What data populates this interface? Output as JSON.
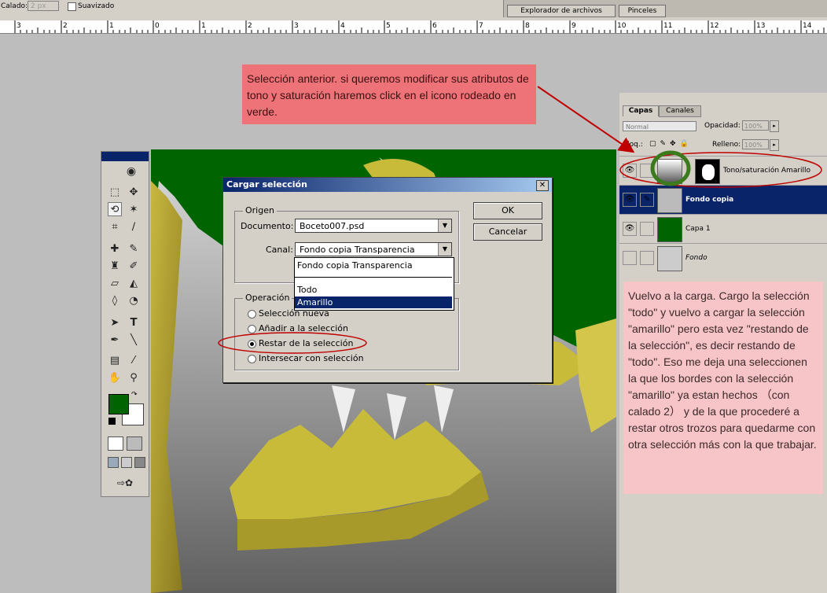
{
  "options_bar": {
    "calado_label": "Calado:",
    "calado_value": "2 px",
    "suavizado_label": "Suavizado"
  },
  "palette_well": {
    "tabs": [
      "Explorador de archivos",
      "Pinceles"
    ]
  },
  "ruler": {
    "ticks": [
      "3",
      "2",
      "1",
      "0",
      "1",
      "2",
      "3",
      "4",
      "5",
      "6",
      "7",
      "8",
      "9",
      "10",
      "11",
      "12",
      "13",
      "14"
    ]
  },
  "notes": {
    "top": "Selección anterior. si queremos modificar sus atributos de tono y saturación haremos click en el icono rodeado en verde.",
    "right": "Vuelvo a la carga. Cargo la selección \"todo\" y vuelvo a cargar la selección \"amarillo\" pero esta vez \"restando de la selección\", es decir restando de \"todo\". Eso me deja una seleccionen la que los bordes con la selección \"amarillo\" ya estan hechos （con calado 2） y de la que procederé a restar otros trozos para quedarme con otra selección más con la que trabajar."
  },
  "dialog": {
    "title": "Cargar selección",
    "origen_label": "Origen",
    "documento_label": "Documento:",
    "documento_value": "Boceto007.psd",
    "canal_label": "Canal:",
    "canal_value": "Fondo copia Transparencia",
    "canal_options": [
      "Fondo copia Transparencia",
      "Todo",
      "Amarillo"
    ],
    "canal_highlighted": "Amarillo",
    "operacion_label": "Operación",
    "operations": [
      "Selección nueva",
      "Añadir a la selección",
      "Restar de la selección",
      "Intersecar con selección"
    ],
    "selected_operation": "Restar de la selección",
    "ok_label": "OK",
    "cancel_label": "Cancelar"
  },
  "layers_panel": {
    "tabs": [
      "Capas",
      "Canales"
    ],
    "active_tab": "Capas",
    "blend_mode": "Normal",
    "opacity_label": "Opacidad:",
    "opacity_value": "100%",
    "lock_label": "Bloq.:",
    "fill_label": "Relleno:",
    "fill_value": "100%",
    "layers": [
      {
        "name": "Tono/saturación Amarillo",
        "visible": true,
        "selected": false
      },
      {
        "name": "Fondo copia",
        "visible": true,
        "selected": true
      },
      {
        "name": "Capa 1",
        "visible": true,
        "selected": false
      },
      {
        "name": "Fondo",
        "visible": false,
        "selected": false
      }
    ]
  },
  "colors": {
    "foreground": "#006400",
    "background": "#ffffff",
    "canvas_green": "#006400",
    "annotation_red": "#c00000",
    "highlight_green": "#3c7a1e"
  }
}
